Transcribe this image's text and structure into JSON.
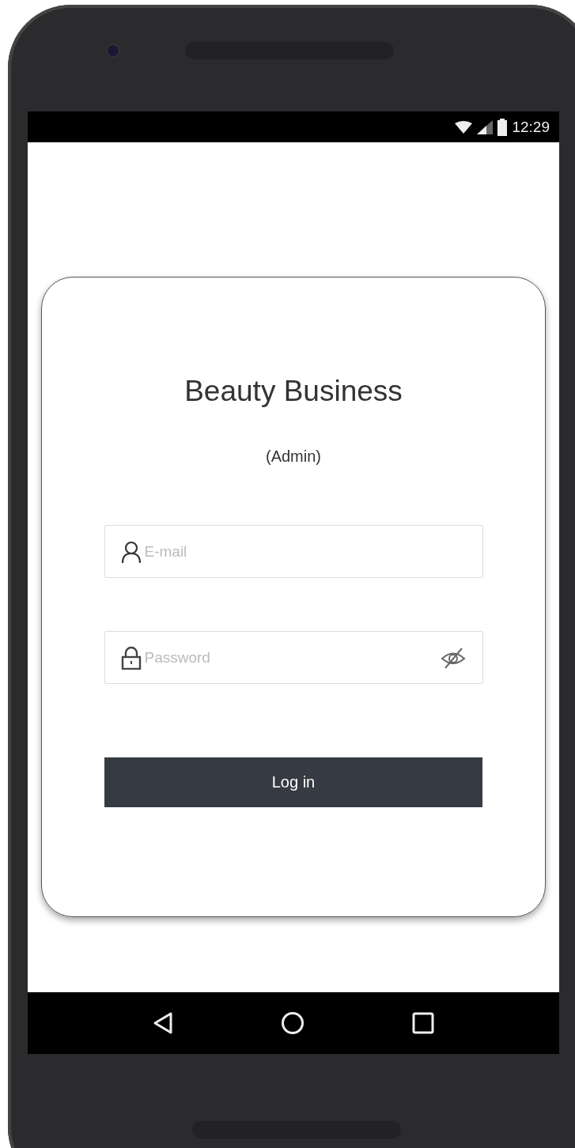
{
  "status_bar": {
    "time": "12:29"
  },
  "login": {
    "title": "Beauty Business",
    "subtitle": "(Admin)",
    "fields": [
      {
        "kind": "email",
        "placeholder": "E-mail"
      },
      {
        "kind": "password",
        "placeholder": "Password"
      }
    ],
    "button": "Log in"
  }
}
